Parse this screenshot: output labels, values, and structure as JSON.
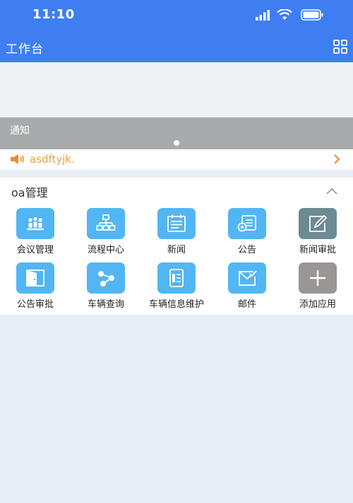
{
  "status_bar": {
    "time": "11:10"
  },
  "header": {
    "title": "工作台",
    "grid_icon": "grid-icon"
  },
  "banner": {
    "caption": "通知"
  },
  "notice": {
    "text": "asdftyjk.",
    "icon": "speaker-icon"
  },
  "panel": {
    "title": "oa管理",
    "apps": [
      {
        "label": "会议管理",
        "icon": "meeting-icon",
        "color": "#51b6f3"
      },
      {
        "label": "流程中心",
        "icon": "flowchart-icon",
        "color": "#51b6f3"
      },
      {
        "label": "新闻",
        "icon": "news-icon",
        "color": "#51b6f3"
      },
      {
        "label": "公告",
        "icon": "announcement-icon",
        "color": "#51b6f3"
      },
      {
        "label": "新闻审批",
        "icon": "edit-icon",
        "color": "#6c8a94"
      },
      {
        "label": "公告审批",
        "icon": "door-icon",
        "color": "#51b6f3"
      },
      {
        "label": "车辆查询",
        "icon": "share-icon",
        "color": "#51b6f3"
      },
      {
        "label": "车辆信息维护",
        "icon": "id-card-icon",
        "color": "#51b6f3"
      },
      {
        "label": "邮件",
        "icon": "mail-icon",
        "color": "#51b6f3"
      },
      {
        "label": "添加应用",
        "icon": "plus-icon",
        "color": "#9a9696"
      }
    ]
  },
  "colors": {
    "header": "#3e7ef0",
    "notice_text": "#e7a53c",
    "page_bg": "#e9edf4"
  }
}
